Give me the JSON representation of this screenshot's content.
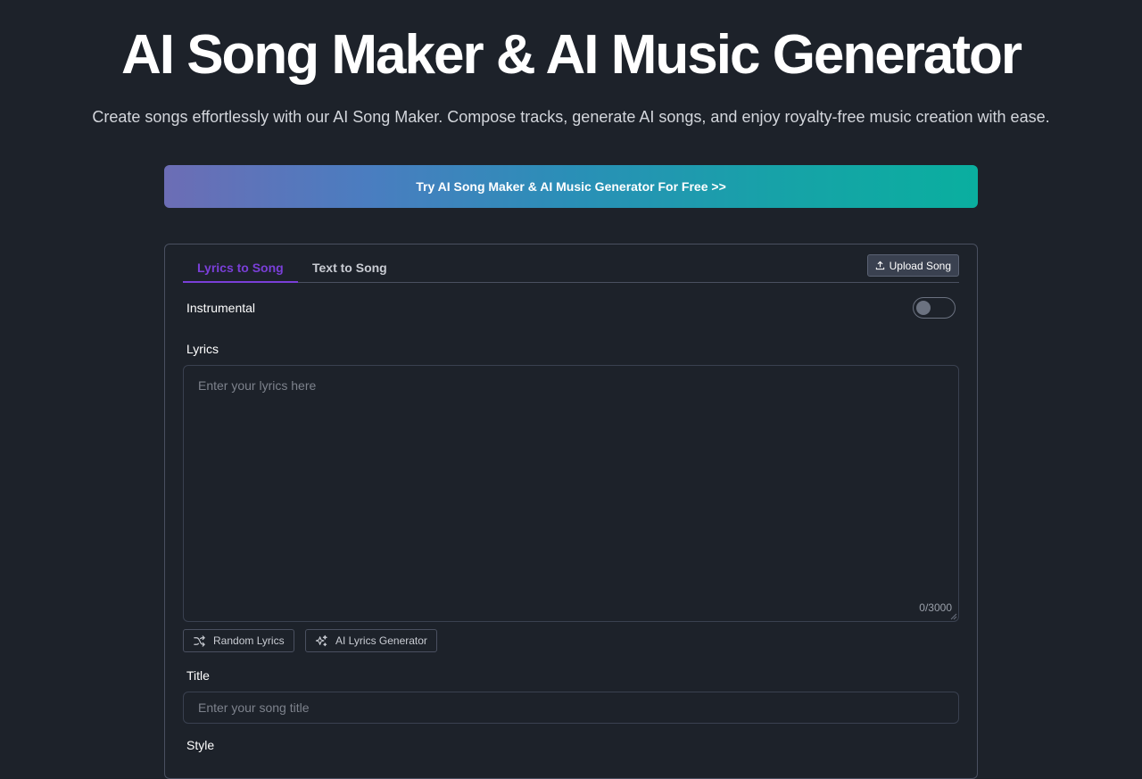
{
  "hero": {
    "title": "AI Song Maker & AI Music Generator",
    "subtitle": "Create songs effortlessly with our AI Song Maker. Compose tracks, generate AI songs, and enjoy royalty-free music creation with ease."
  },
  "cta": {
    "label": "Try AI Song Maker & AI Music Generator For Free >>"
  },
  "panel": {
    "tabs": [
      {
        "label": "Lyrics to Song",
        "active": true
      },
      {
        "label": "Text to Song",
        "active": false
      }
    ],
    "upload_label": "Upload Song",
    "instrumental_label": "Instrumental",
    "instrumental_on": false,
    "lyrics_label": "Lyrics",
    "lyrics_placeholder": "Enter your lyrics here",
    "lyrics_counter": "0/3000",
    "random_lyrics_label": "Random Lyrics",
    "ai_lyrics_label": "AI Lyrics Generator",
    "title_label": "Title",
    "title_placeholder": "Enter your song title",
    "next_label": "Style"
  },
  "colors": {
    "background": "#1d222a",
    "accent": "#7a3fd8",
    "cta_gradient_start": "#6c6db5",
    "cta_gradient_end": "#0aaf9f"
  },
  "icons": {
    "upload": "upload-icon",
    "random": "shuffle-icon",
    "ai": "sparkles-icon"
  }
}
